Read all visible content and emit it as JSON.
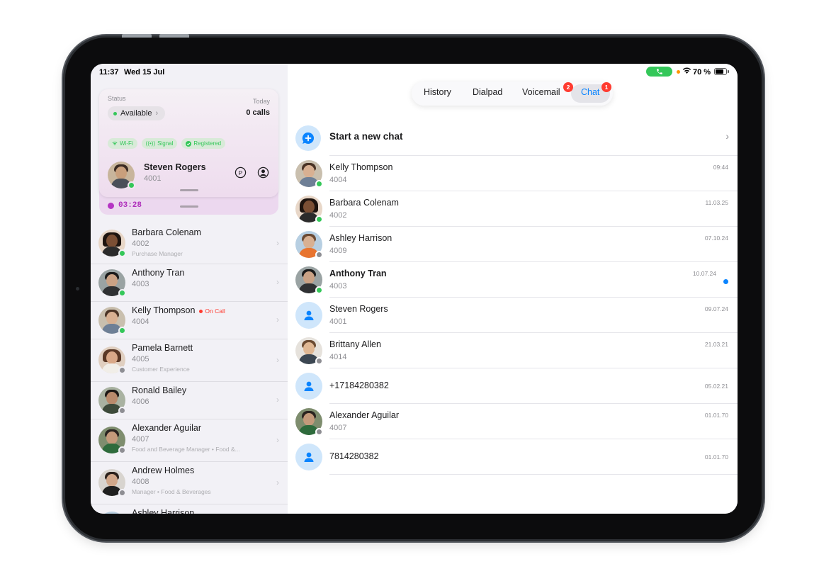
{
  "status_bar": {
    "time": "11:37",
    "date": "Wed 15 Jul",
    "battery": "70 %"
  },
  "sidebar": {
    "status_card": {
      "status_label": "Status",
      "status_value": "Available",
      "today_label": "Today",
      "calls": "0 calls",
      "badges": [
        "Wi-Fi",
        "Signal",
        "Registered"
      ],
      "user_name": "Steven Rogers",
      "user_ext": "4001",
      "timer": "03:28"
    },
    "contacts": [
      {
        "name": "Barbara Colenam",
        "ext": "4002",
        "sub": "Purchase Manager",
        "online": true
      },
      {
        "name": "Anthony Tran",
        "ext": "4003",
        "sub": "",
        "online": true
      },
      {
        "name": "Kelly Thompson",
        "ext": "4004",
        "sub": "",
        "online": true,
        "badge": "On Call"
      },
      {
        "name": "Pamela Barnett",
        "ext": "4005",
        "sub": "Customer Experience",
        "online": false
      },
      {
        "name": "Ronald Bailey",
        "ext": "4006",
        "sub": "",
        "online": false
      },
      {
        "name": "Alexander Aguilar",
        "ext": "4007",
        "sub": "Food and Beverage Manager • Food &...",
        "online": false
      },
      {
        "name": "Andrew Holmes",
        "ext": "4008",
        "sub": "Manager • Food & Beverages",
        "online": false
      },
      {
        "name": "Ashley Harrison",
        "ext": "",
        "sub": "",
        "online": false
      }
    ]
  },
  "tabs": [
    {
      "label": "History",
      "badge": ""
    },
    {
      "label": "Dialpad",
      "badge": ""
    },
    {
      "label": "Voicemail",
      "badge": "2"
    },
    {
      "label": "Chat",
      "badge": "1",
      "active": true
    }
  ],
  "new_chat": {
    "label": "Start a new chat"
  },
  "chats": [
    {
      "name": "Kelly Thompson",
      "ext": "4004",
      "date": "09:44",
      "online": true,
      "unread": false
    },
    {
      "name": "Barbara Colenam",
      "ext": "4002",
      "date": "11.03.25",
      "online": true,
      "unread": false
    },
    {
      "name": "Ashley Harrison",
      "ext": "4009",
      "date": "07.10.24",
      "online": false,
      "unread": false
    },
    {
      "name": "Anthony Tran",
      "ext": "4003",
      "date": "10.07.24",
      "online": true,
      "unread": true
    },
    {
      "name": "Steven Rogers",
      "ext": "4001",
      "date": "09.07.24",
      "generic": true
    },
    {
      "name": "Brittany Allen",
      "ext": "4014",
      "date": "21.03.21",
      "online": false,
      "unread": false
    },
    {
      "name": "+17184280382",
      "ext": "",
      "date": "05.02.21",
      "generic": true
    },
    {
      "name": "Alexander Aguilar",
      "ext": "4007",
      "date": "01.01.70",
      "online": false,
      "unread": false
    },
    {
      "name": "7814280382",
      "ext": "",
      "date": "01.01.70",
      "generic": true
    }
  ],
  "colors": {
    "accent": "#0a84ff",
    "online": "#34c759",
    "offline": "#8e8e93",
    "badge": "#ff3b30",
    "timer": "#af2fbb"
  }
}
